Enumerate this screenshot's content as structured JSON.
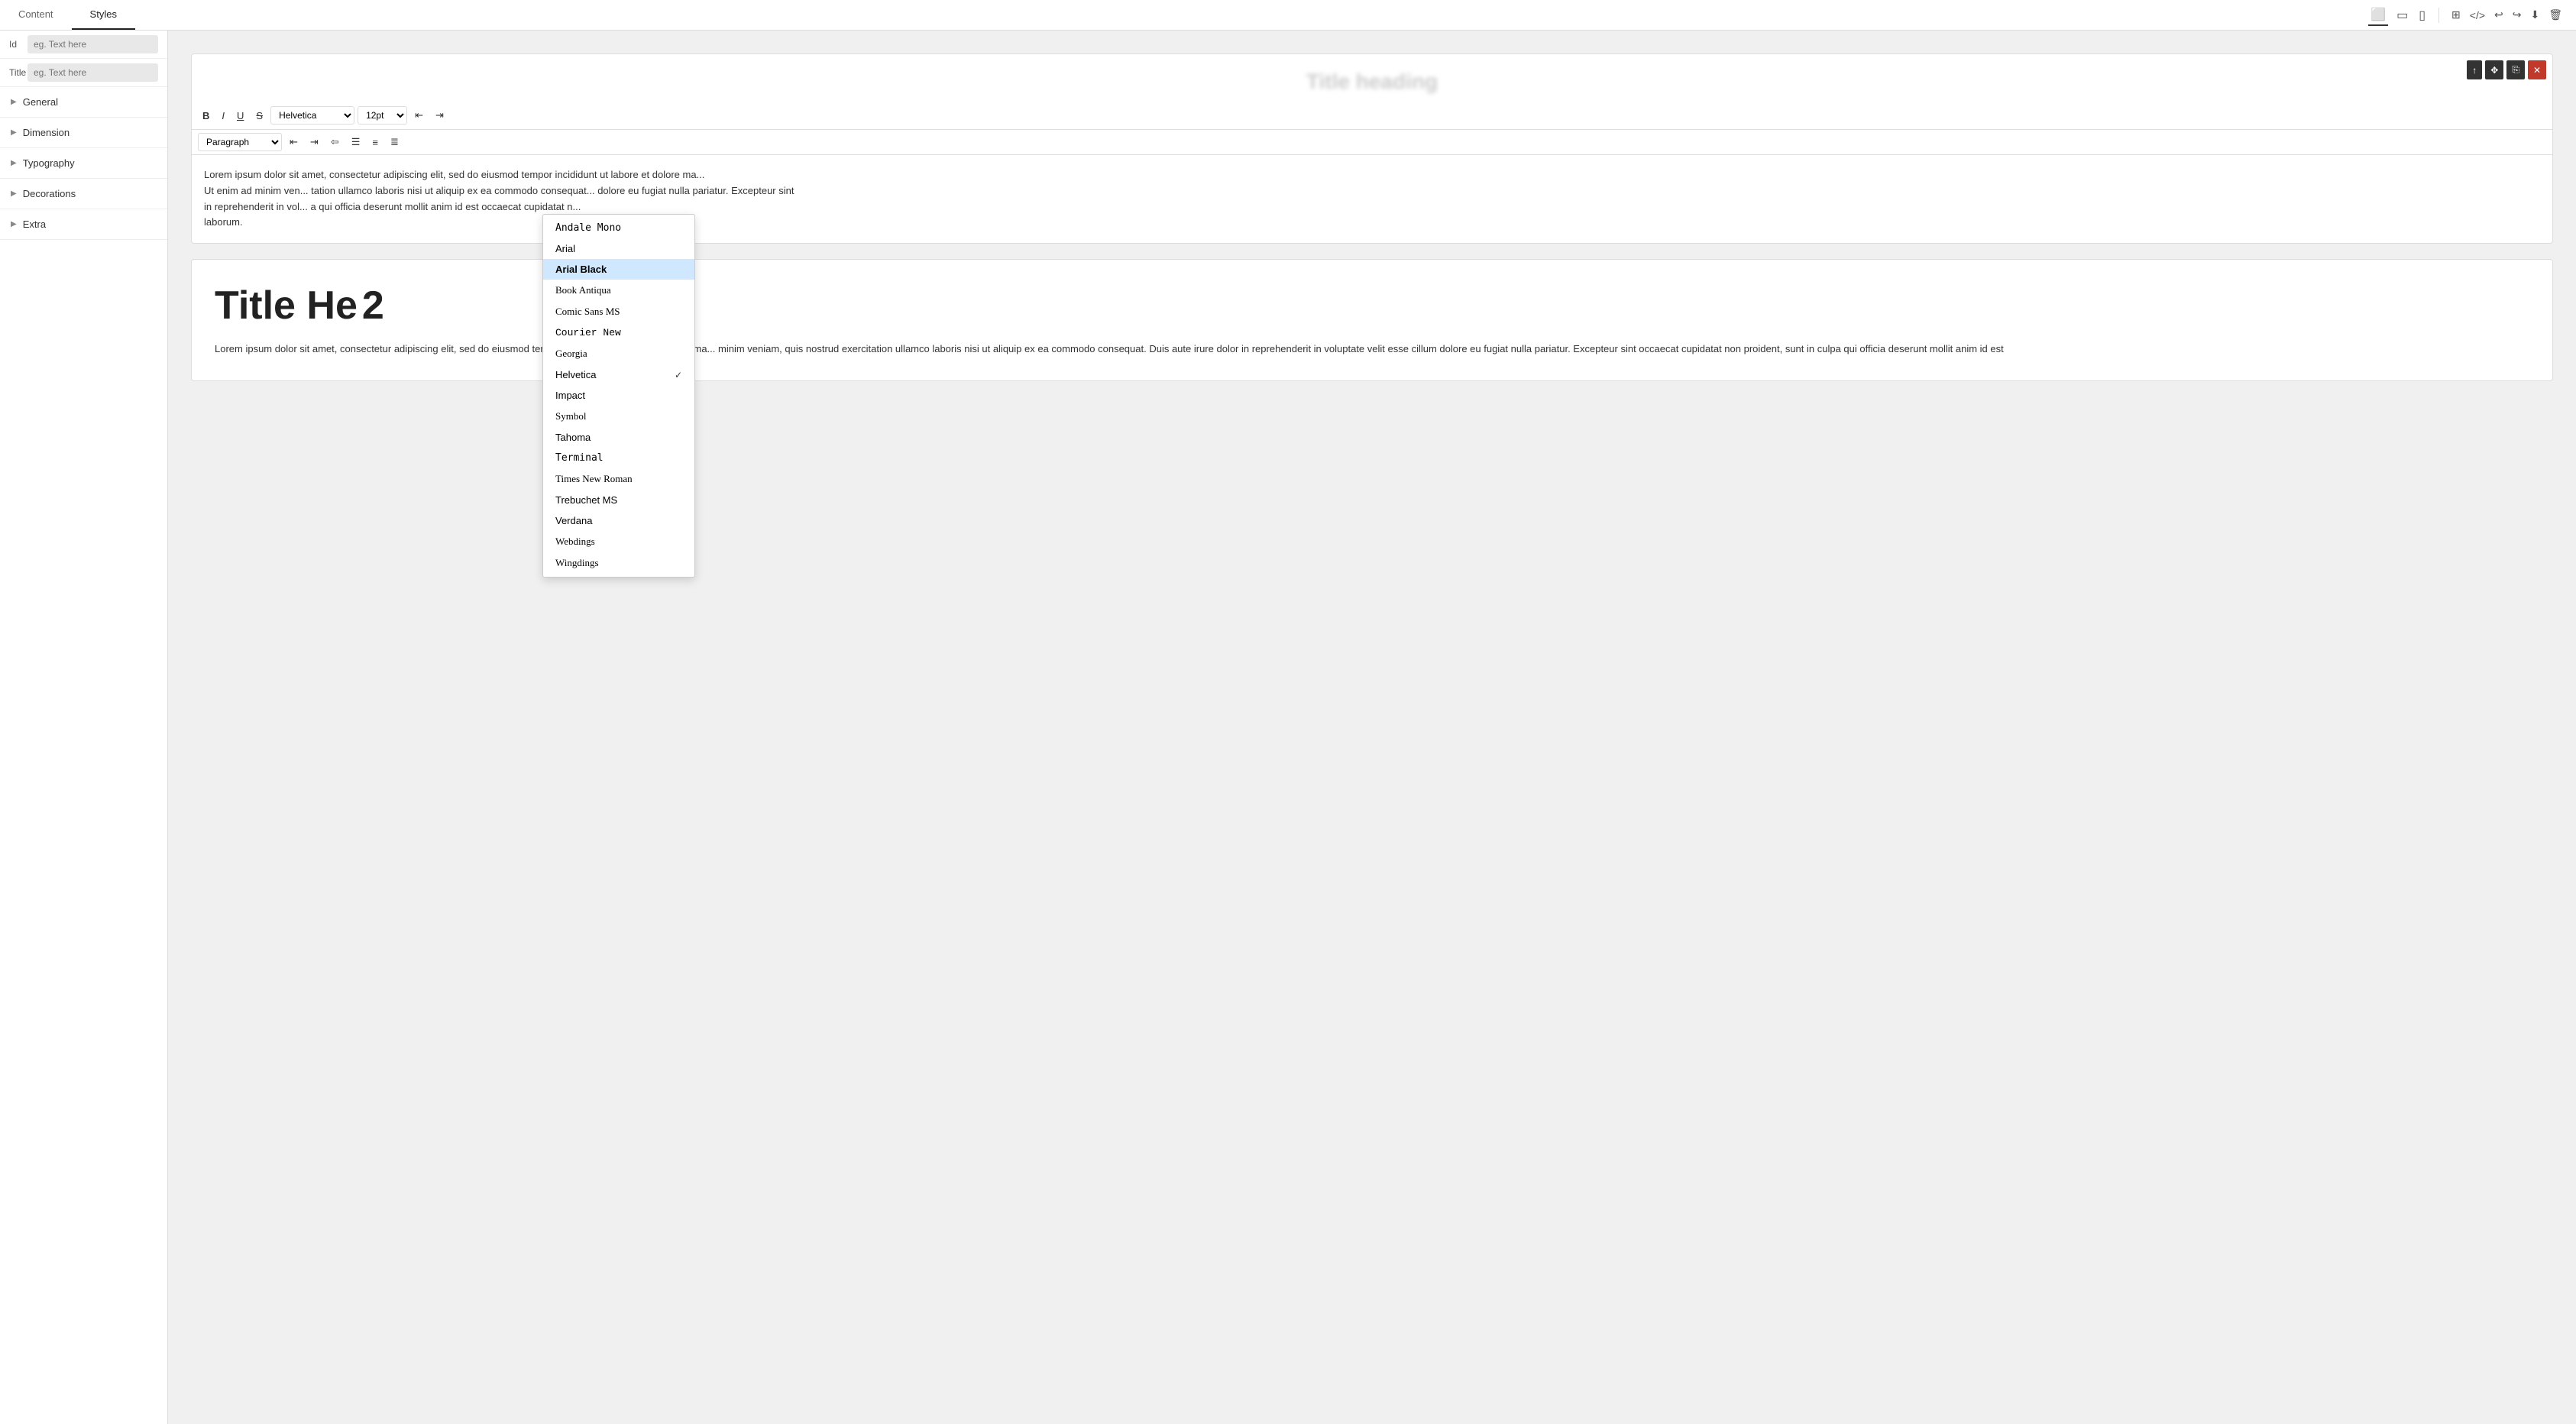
{
  "header": {
    "tabs": [
      {
        "id": "content",
        "label": "Content"
      },
      {
        "id": "styles",
        "label": "Styles",
        "active": true
      }
    ],
    "device_icons": [
      "desktop",
      "tablet",
      "mobile"
    ],
    "right_icons": [
      "grid",
      "code",
      "undo",
      "redo",
      "download",
      "delete"
    ]
  },
  "sidebar": {
    "id_label": "Id",
    "id_placeholder": "eg. Text here",
    "title_label": "Title",
    "title_placeholder": "eg. Text here",
    "sections": [
      {
        "id": "general",
        "label": "General"
      },
      {
        "id": "dimension",
        "label": "Dimension"
      },
      {
        "id": "typography",
        "label": "Typography"
      },
      {
        "id": "decorations",
        "label": "Decorations"
      },
      {
        "id": "extra",
        "label": "Extra"
      }
    ]
  },
  "editor": {
    "blurred_heading": "Title heading",
    "toolbar": {
      "bold": "B",
      "italic": "I",
      "underline": "U",
      "strikethrough": "S",
      "font_family": "Helvetica",
      "font_size": "12pt",
      "indent_decrease": "←",
      "indent_increase": "→",
      "paragraph_label": "Paragraph",
      "align_left": "≡",
      "align_center": "≡",
      "align_right": "≡",
      "list_unordered": "≡",
      "list_ordered": "≡"
    },
    "content": "Lorem ipsum dolor sit amet, consectetur adipiscing elit, sed do eiusmod tempor incididunt ut labore et dolore ma... Ut enim ad minim ven... tation ullamco laboris nisi ut aliquip ex ea commodo consequat... dolore eu fugiat nulla pariatur. Excepteur sint in reprehenderit in vol... a qui officia deserunt mollit anim id est occaecat cupidatat n... laborum.",
    "float_buttons": [
      "move-up",
      "move",
      "copy",
      "delete"
    ]
  },
  "font_dropdown": {
    "fonts": [
      {
        "id": "andale-mono",
        "label": "Andale Mono",
        "class": "andale-mono"
      },
      {
        "id": "arial",
        "label": "Arial",
        "class": "arial"
      },
      {
        "id": "arial-black",
        "label": "Arial Black",
        "class": "arial-black",
        "selected": true
      },
      {
        "id": "book-antiqua",
        "label": "Book Antiqua",
        "class": "book-antiqua"
      },
      {
        "id": "comic-sans-ms",
        "label": "Comic Sans MS",
        "class": "comic-sans"
      },
      {
        "id": "courier-new",
        "label": "Courier New",
        "class": "courier-new"
      },
      {
        "id": "georgia",
        "label": "Georgia",
        "class": "georgia"
      },
      {
        "id": "helvetica",
        "label": "Helvetica",
        "class": "helvetica",
        "checked": true
      },
      {
        "id": "impact",
        "label": "Impact",
        "class": "impact"
      },
      {
        "id": "symbol",
        "label": "Symbol",
        "class": "symbol"
      },
      {
        "id": "tahoma",
        "label": "Tahoma",
        "class": "tahoma"
      },
      {
        "id": "terminal",
        "label": "Terminal",
        "class": "terminal"
      },
      {
        "id": "times-new-roman",
        "label": "Times New Roman",
        "class": "times-new-roman"
      },
      {
        "id": "trebuchet-ms",
        "label": "Trebuchet MS",
        "class": "trebuchet"
      },
      {
        "id": "verdana",
        "label": "Verdana",
        "class": "verdana"
      },
      {
        "id": "webdings",
        "label": "Webdings",
        "class": "webdings"
      },
      {
        "id": "wingdings",
        "label": "Wingdings",
        "class": "wingdings"
      }
    ]
  },
  "second_card": {
    "title": "Title He",
    "title_suffix": "2",
    "content": "Lorem ipsum dolor sit amet, consectetur adipiscing elit, sed do eiusmod tempor incididunt ut labore et dolore ma... minim veniam, quis nostrud exercitation ullamco laboris nisi ut aliquip ex ea commodo consequat. Duis aute irure dolor in reprehenderit in voluptate velit esse cillum dolore eu fugiat nulla pariatur. Excepteur sint occaecat cupidatat non proident, sunt in culpa qui officia deserunt mollit anim id est"
  }
}
